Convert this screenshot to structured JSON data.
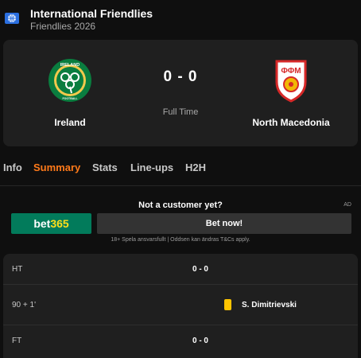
{
  "league": {
    "title": "International Friendlies",
    "subtitle": "Friendlies 2026",
    "icon": "globe-icon"
  },
  "match": {
    "home_team": "Ireland",
    "away_team": "North Macedonia",
    "score": "0 - 0",
    "status": "Full Time",
    "home_logo_text": "IRELAND",
    "home_logo_bottom_text": "FOOTBALL",
    "away_logo_text": "ФФМ"
  },
  "tabs": [
    {
      "label": "Info",
      "active": false
    },
    {
      "label": "Summary",
      "active": true
    },
    {
      "label": "Stats",
      "active": false
    },
    {
      "label": "Line-ups",
      "active": false
    },
    {
      "label": "H2H",
      "active": false
    }
  ],
  "ad": {
    "prompt": "Not a customer yet?",
    "tag": "AD",
    "brand_part1": "bet",
    "brand_part2": "365",
    "button_label": "Bet now!",
    "disclaimer": "18+ Spela ansvarsfullt | Oddsen kan ändras T&Cs apply."
  },
  "events": [
    {
      "time": "HT",
      "score": "0 - 0"
    },
    {
      "time": "90 + 1'",
      "type": "yellow-card",
      "player": "S. Dimitrievski"
    },
    {
      "time": "FT",
      "score": "0 - 0"
    }
  ],
  "colors": {
    "accent": "#ff7a1a",
    "bet365_green": "#027b5b",
    "bet365_yellow": "#ffdf1b",
    "yellow_card": "#ffc400",
    "card_bg": "#1f1f1f",
    "page_bg": "#0f0f0f"
  }
}
